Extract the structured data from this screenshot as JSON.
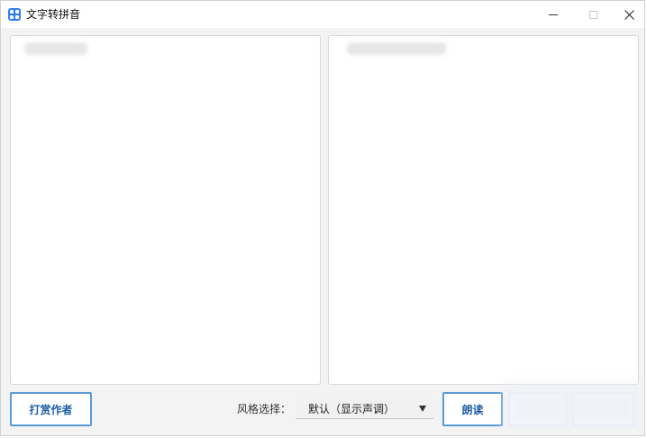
{
  "window": {
    "title": "文字转拼音"
  },
  "input_panel": {
    "value": ""
  },
  "output_panel": {
    "value": ""
  },
  "footer": {
    "tip_button_label": "打赏作者",
    "style_label": "风格选择：",
    "style_select": {
      "selected": "默认（显示声调）"
    },
    "read_button_label": "朗读"
  }
}
